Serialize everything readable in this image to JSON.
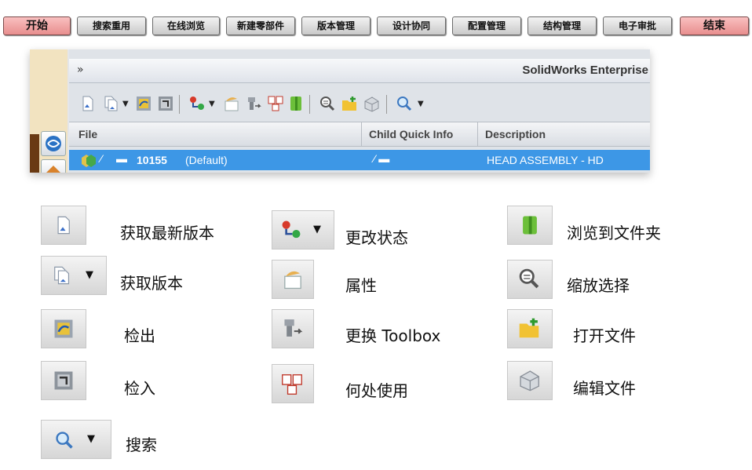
{
  "nav": {
    "items": [
      "开始",
      "搜索重用",
      "在线浏览",
      "新建零部件",
      "版本管理",
      "设计协同",
      "配置管理",
      "结构管理",
      "电子审批",
      "结束"
    ]
  },
  "window": {
    "chevron": "»",
    "title": "SolidWorks Enterprise",
    "columns": [
      "File",
      "Child Quick Info",
      "Description"
    ],
    "row": {
      "number": "10155",
      "config": "(Default)",
      "description": "HEAD ASSEMBLY - HD"
    }
  },
  "legend": {
    "items": [
      {
        "label": "获取最新版本",
        "icon": "get-latest-icon"
      },
      {
        "label": "获取版本",
        "icon": "get-version-icon"
      },
      {
        "label": "检出",
        "icon": "check-out-icon"
      },
      {
        "label": "检入",
        "icon": "check-in-icon"
      },
      {
        "label": "搜索",
        "icon": "search-icon"
      },
      {
        "label": "更改状态",
        "icon": "change-state-icon"
      },
      {
        "label": "属性",
        "icon": "properties-icon"
      },
      {
        "label": "更换 Toolbox",
        "icon": "replace-toolbox-icon"
      },
      {
        "label": "何处使用",
        "icon": "where-used-icon"
      },
      {
        "label": "浏览到文件夹",
        "icon": "browse-folder-icon"
      },
      {
        "label": "缩放选择",
        "icon": "zoom-selection-icon"
      },
      {
        "label": "打开文件",
        "icon": "open-file-icon"
      },
      {
        "label": "编辑文件",
        "icon": "edit-file-icon"
      }
    ]
  }
}
